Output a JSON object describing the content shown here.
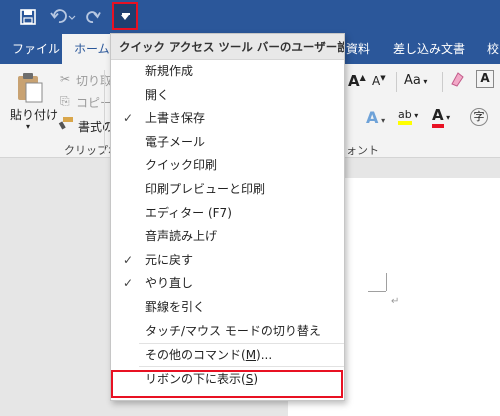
{
  "qat": {
    "save_icon": "save-icon",
    "undo_icon": "undo-icon",
    "redo_icon": "redo-icon",
    "customize_icon": "chevron-down-icon"
  },
  "tabs": [
    {
      "label": "ファイル"
    },
    {
      "label": "ホーム"
    },
    {
      "label": "資料"
    },
    {
      "label": "差し込み文書"
    },
    {
      "label": "校"
    }
  ],
  "ribbon": {
    "paste_label": "貼り付け",
    "cut_label": "切り取",
    "copy_label": "コピー",
    "format_painter_label": "書式の",
    "clipboard_group": "クリップボー",
    "font_group": "ォント",
    "font_grow": "A",
    "font_shrink": "A",
    "change_case": "Aa",
    "text_effects": "A",
    "font_color": "A",
    "highlight": "ab"
  },
  "menu": {
    "header": "クイック アクセス ツール バーのユーザー設定",
    "items": [
      {
        "label": "新規作成",
        "checked": false
      },
      {
        "label": "開く",
        "checked": false
      },
      {
        "label": "上書き保存",
        "checked": true
      },
      {
        "label": "電子メール",
        "checked": false
      },
      {
        "label": "クイック印刷",
        "checked": false
      },
      {
        "label": "印刷プレビューと印刷",
        "checked": false
      },
      {
        "label": "エディター (F7)",
        "checked": false
      },
      {
        "label": "音声読み上げ",
        "checked": false
      },
      {
        "label": "元に戻す",
        "checked": true
      },
      {
        "label": "やり直し",
        "checked": true
      },
      {
        "label": "罫線を引く",
        "checked": false
      },
      {
        "label": "タッチ/マウス モードの切り替え",
        "checked": false
      }
    ],
    "more_commands_pre": "その他のコマンド(",
    "more_commands_key": "M",
    "more_commands_post": ")...",
    "show_below_pre": "リボンの下に表示(",
    "show_below_key": "S",
    "show_below_post": ")",
    "check_mark": "✓"
  },
  "doc": {
    "paragraph_mark": "↵"
  }
}
